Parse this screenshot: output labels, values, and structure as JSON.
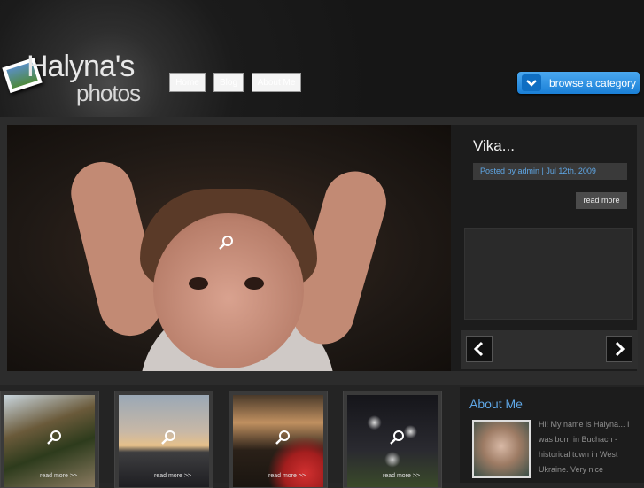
{
  "site": {
    "logo_line1": "Halyna's",
    "logo_line2": "photos"
  },
  "nav": {
    "items": [
      {
        "label": "Home"
      },
      {
        "label": "Blog"
      },
      {
        "label": "About Me"
      }
    ]
  },
  "browse": {
    "label": "browse a category"
  },
  "featured": {
    "title": "Vika...",
    "meta": "Posted by admin | Jul 12th, 2009",
    "read_more": "read more"
  },
  "thumbnails": [
    {
      "read_more": "read more >>"
    },
    {
      "read_more": "read more >>"
    },
    {
      "read_more": "read more >>"
    },
    {
      "read_more": "read more >>"
    }
  ],
  "about": {
    "heading": "About Me",
    "text": "Hi! My name is Halyna... I was born in Buchach - historical town in West Ukraine. Very nice"
  },
  "colors": {
    "accent": "#5fa7e6",
    "button_blue": "#1a7fd6",
    "background": "#262626"
  }
}
